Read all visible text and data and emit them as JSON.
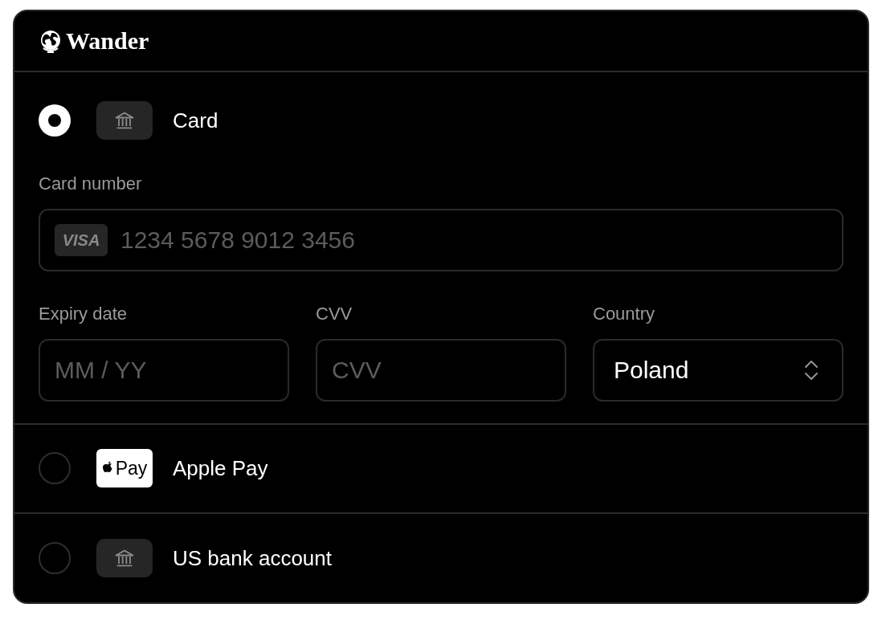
{
  "brand": {
    "name": "Wander"
  },
  "methods": [
    {
      "kind": "card",
      "label": "Card",
      "selected": true,
      "logo": {
        "kind": "bank"
      }
    },
    {
      "kind": "wallet",
      "label": "Apple Pay",
      "selected": false,
      "logo": {
        "kind": "apple_pay",
        "text": "Pay"
      }
    },
    {
      "kind": "bank",
      "label": "US bank account",
      "selected": false,
      "logo": {
        "kind": "bank"
      }
    }
  ],
  "card_form": {
    "card_number": {
      "label": "Card number",
      "brand": "VISA",
      "placeholder": "1234 5678 9012 3456"
    },
    "expiry": {
      "label": "Expiry date",
      "placeholder": "MM / YY"
    },
    "cvv": {
      "label": "CVV",
      "placeholder": "CVV"
    },
    "country": {
      "label": "Country",
      "value": "Poland"
    }
  }
}
